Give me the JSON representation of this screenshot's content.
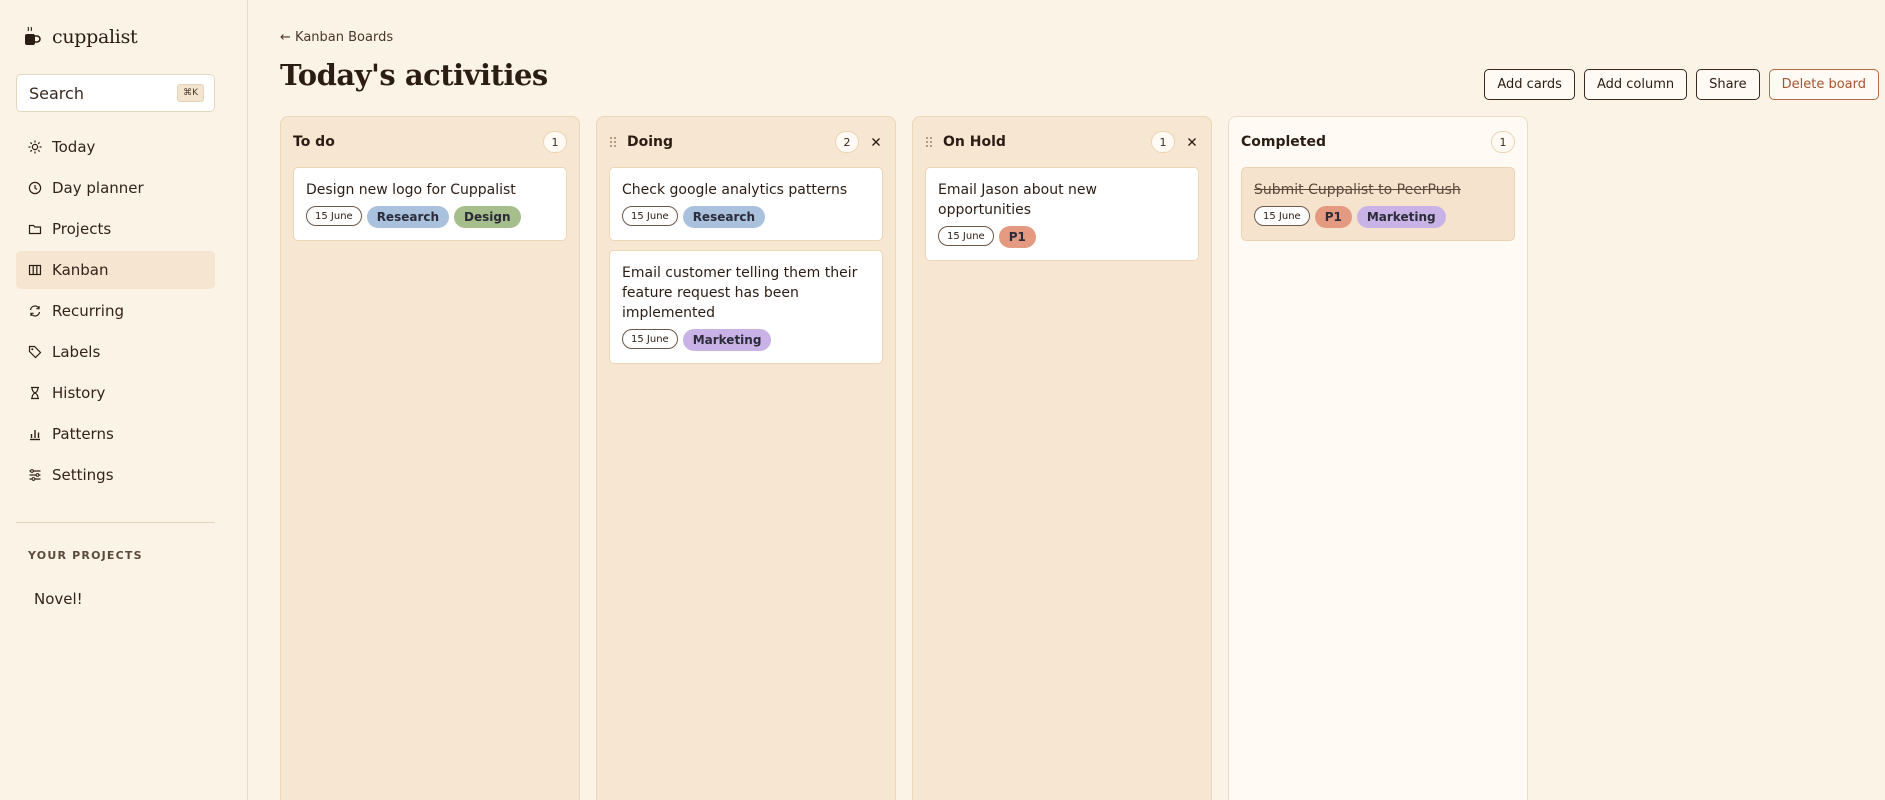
{
  "app": {
    "name": "cuppalist"
  },
  "search": {
    "label": "Search",
    "shortcut": "⌘K"
  },
  "nav": [
    {
      "label": "Today",
      "icon": "sun-icon",
      "active": false
    },
    {
      "label": "Day planner",
      "icon": "clock-icon",
      "active": false
    },
    {
      "label": "Projects",
      "icon": "folder-icon",
      "active": false
    },
    {
      "label": "Kanban",
      "icon": "kanban-icon",
      "active": true
    },
    {
      "label": "Recurring",
      "icon": "refresh-icon",
      "active": false
    },
    {
      "label": "Labels",
      "icon": "tag-icon",
      "active": false
    },
    {
      "label": "History",
      "icon": "hourglass-icon",
      "active": false
    },
    {
      "label": "Patterns",
      "icon": "bar-chart-icon",
      "active": false
    },
    {
      "label": "Settings",
      "icon": "sliders-icon",
      "active": false
    }
  ],
  "projects": {
    "heading": "YOUR PROJECTS",
    "items": [
      "Novel!"
    ]
  },
  "header": {
    "back": "← Kanban Boards",
    "title": "Today's activities",
    "buttons": [
      "Add cards",
      "Add column",
      "Share",
      "Delete board"
    ]
  },
  "colors": {
    "research": "#a9c1dd",
    "design": "#a6bd8c",
    "marketing": "#c9b3e6",
    "p1": "#e39a80"
  },
  "columns": [
    {
      "title": "To do",
      "count": "1",
      "draggable": false,
      "closable": false,
      "cards": [
        {
          "title": "Design new logo for Cuppalist",
          "date": "15 June",
          "done": false,
          "tags": [
            "Research",
            "Design"
          ]
        }
      ]
    },
    {
      "title": "Doing",
      "count": "2",
      "draggable": true,
      "closable": true,
      "cards": [
        {
          "title": "Check google analytics patterns",
          "date": "15 June",
          "done": false,
          "tags": [
            "Research"
          ]
        },
        {
          "title": "Email customer telling them their feature request has been implemented",
          "date": "15 June",
          "done": false,
          "tags": [
            "Marketing"
          ]
        }
      ]
    },
    {
      "title": "On Hold",
      "count": "1",
      "draggable": true,
      "closable": true,
      "cards": [
        {
          "title": "Email Jason about new opportunities",
          "date": "15 June",
          "done": false,
          "tags": [
            "P1"
          ]
        }
      ]
    },
    {
      "title": "Completed",
      "count": "1",
      "draggable": false,
      "closable": false,
      "cards": [
        {
          "title": "Submit Cuppalist to PeerPush",
          "date": "15 June",
          "done": true,
          "tags": [
            "P1",
            "Marketing"
          ]
        }
      ]
    }
  ]
}
